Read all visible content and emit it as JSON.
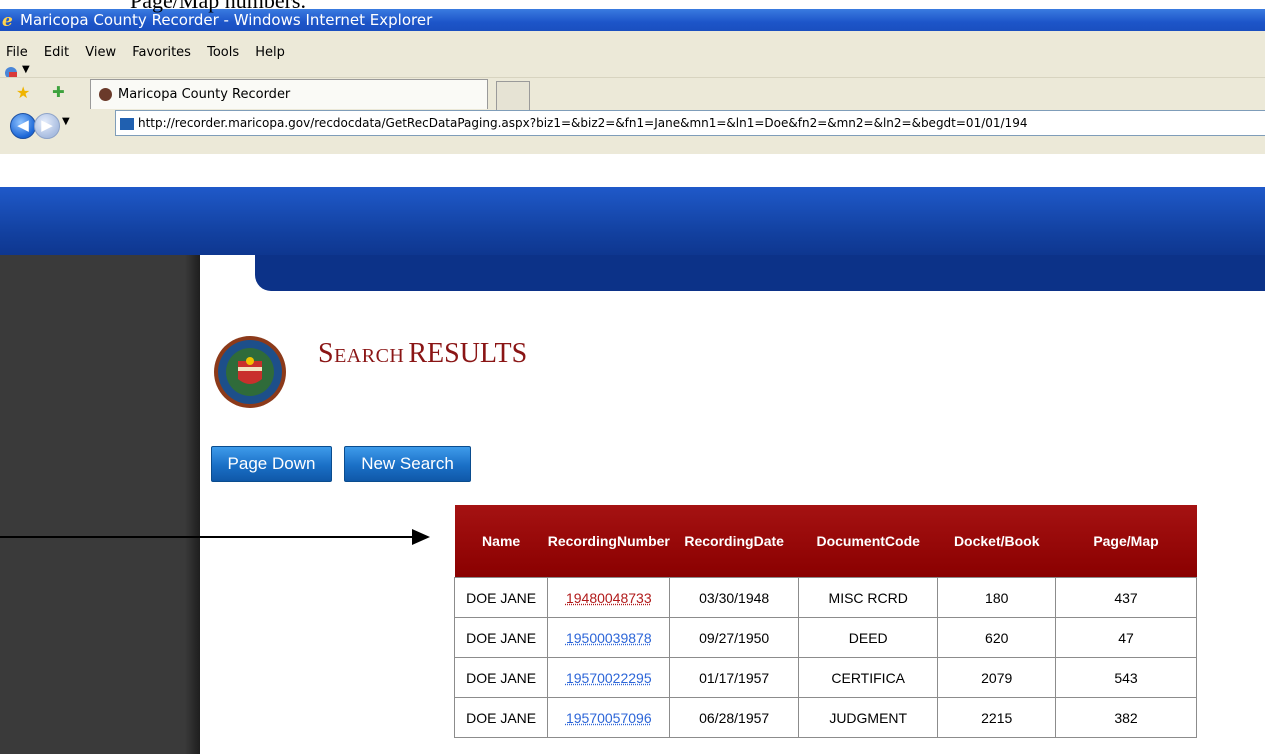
{
  "document": {
    "caption": "Page/Map numbers."
  },
  "window": {
    "title": "Maricopa County Recorder - Windows Internet Explorer"
  },
  "menu": {
    "items": [
      "File",
      "Edit",
      "View",
      "Favorites",
      "Tools",
      "Help"
    ]
  },
  "address_bar": {
    "url": "http://recorder.maricopa.gov/recdocdata/GetRecDataPaging.aspx?biz1=&biz2=&fn1=Jane&mn1=&ln1=Doe&fn2=&mn2=&ln2=&begdt=01/01/194"
  },
  "tabs": [
    {
      "label": "Maricopa County Recorder"
    }
  ],
  "page": {
    "heading_small": "Search",
    "heading_big": "RESULTS",
    "buttons": {
      "page_down": "Page Down",
      "new_search": "New Search"
    }
  },
  "results": {
    "columns": [
      "Name",
      "RecordingNumber",
      "RecordingDate",
      "DocumentCode",
      "Docket/Book",
      "Page/Map"
    ],
    "rows": [
      {
        "name": "DOE JANE",
        "recording_number": "19480048733",
        "recording_date": "03/30/1948",
        "document_code": "MISC RCRD",
        "docket_book": "180",
        "page_map": "437"
      },
      {
        "name": "DOE JANE",
        "recording_number": "19500039878",
        "recording_date": "09/27/1950",
        "document_code": "DEED",
        "docket_book": "620",
        "page_map": "47"
      },
      {
        "name": "DOE JANE",
        "recording_number": "19570022295",
        "recording_date": "01/17/1957",
        "document_code": "CERTIFICA",
        "docket_book": "2079",
        "page_map": "543"
      },
      {
        "name": "DOE JANE",
        "recording_number": "19570057096",
        "recording_date": "06/28/1957",
        "document_code": "JUDGMENT",
        "docket_book": "2215",
        "page_map": "382"
      }
    ]
  },
  "colors": {
    "accent_red": "#8a0000",
    "link_blue": "#2d66d8",
    "visited_link": "#b11a1a",
    "header_blue": "#12409f"
  }
}
